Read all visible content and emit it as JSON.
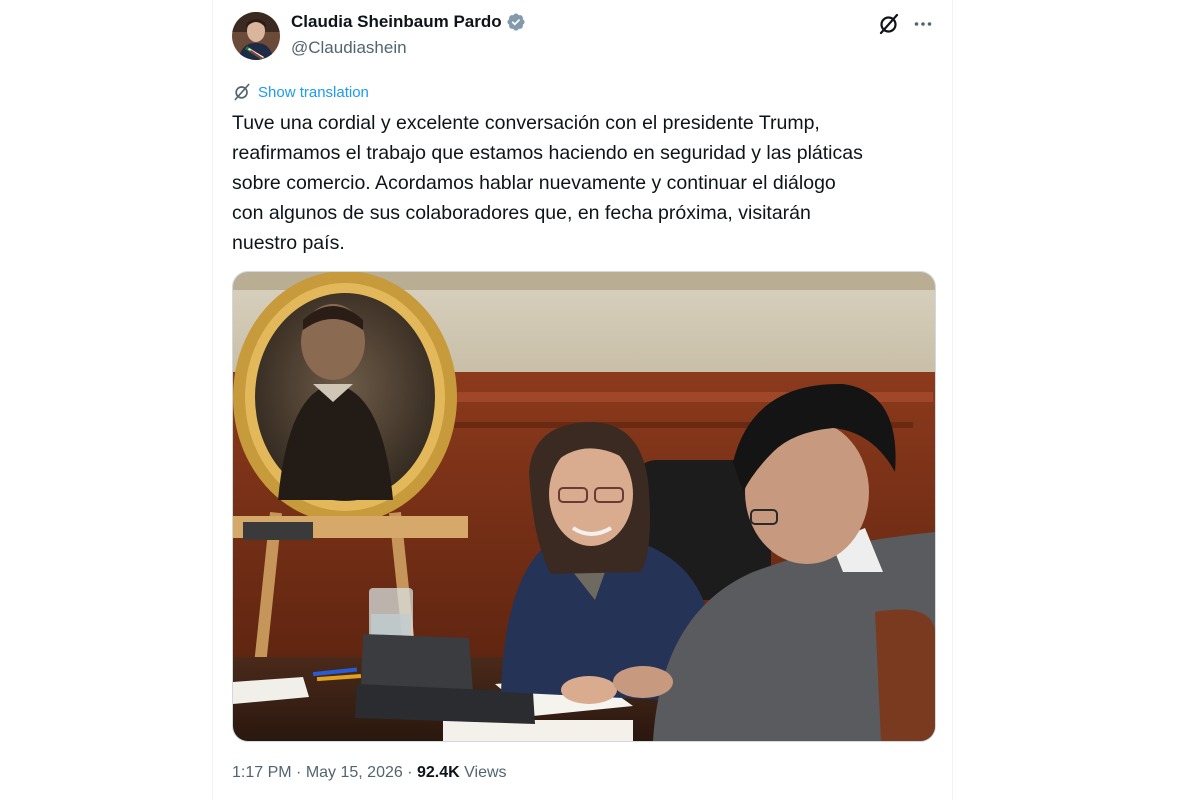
{
  "tweet": {
    "display_name": "Claudia Sheinbaum Pardo",
    "handle": "@Claudiashein",
    "translate_label": "Show translation",
    "text": "Tuve una cordial y excelente conversación con el presidente Trump,\nreafirmamos el trabajo que estamos haciendo en seguridad y las pláticas\nsobre comercio. Acordamos hablar nuevamente y continuar el diálogo\ncon algunos de sus colaboradores que, en fecha próxima, visitarán\nnuestro país.",
    "time": "1:17 PM",
    "date": "May 15, 2026",
    "separator": " · ",
    "views_count": "92.4K",
    "views_label": "Views"
  },
  "icons": {
    "verified": "verified-badge-icon",
    "grok": "grok-icon",
    "more": "more-options-icon",
    "translate": "translate-icon"
  },
  "colors": {
    "accent": "#1d9bf0",
    "text_primary": "#0f1419",
    "text_secondary": "#536471",
    "verified": "#829aab"
  }
}
